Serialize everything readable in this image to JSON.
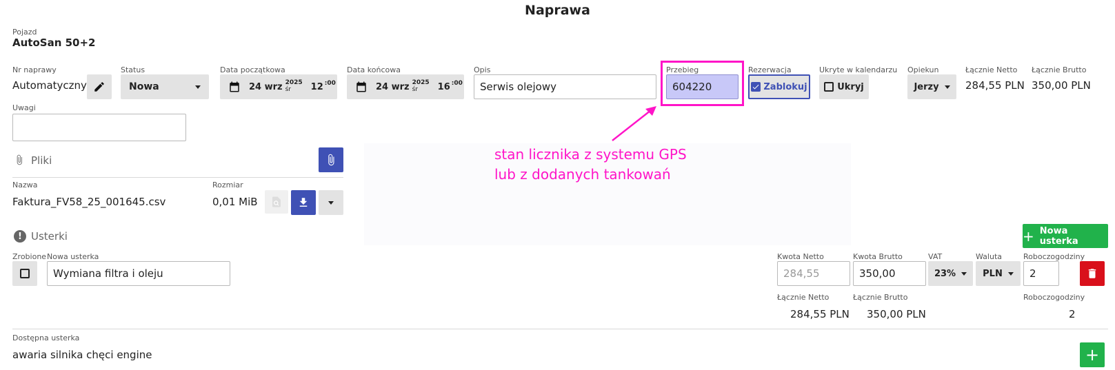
{
  "title": "Naprawa",
  "vehicle": {
    "label": "Pojazd",
    "value": "AutoSan 50+2"
  },
  "fields": {
    "nr_label": "Nr naprawy",
    "nr_value": "Automatyczny",
    "status_label": "Status",
    "status_value": "Nowa",
    "start_label": "Data początkowa",
    "start_day": "24 wrz",
    "start_year": "2025",
    "start_weekday": "śr",
    "start_hour": "12",
    "start_min": "00",
    "end_label": "Data końcowa",
    "end_day": "24 wrz",
    "end_year": "2025",
    "end_weekday": "śr",
    "end_hour": "16",
    "end_min": "00",
    "desc_label": "Opis",
    "desc_value": "Serwis olejowy",
    "mileage_label": "Przebieg",
    "mileage_value": "604220",
    "reservation_label": "Rezerwacja",
    "reservation_value": "Zablokuj",
    "hidden_label": "Ukryte w kalendarzu",
    "hidden_value": "Ukryj",
    "caretaker_label": "Opiekun",
    "caretaker_value": "Jerzy",
    "net_label": "Łącznie Netto",
    "net_value": "284,55 PLN",
    "gross_label": "Łącznie Brutto",
    "gross_value": "350,00 PLN",
    "notes_label": "Uwagi"
  },
  "annotation": {
    "line1": "stan licznika z systemu GPS",
    "line2": "lub z dodanych tankowań"
  },
  "files": {
    "heading": "Pliki",
    "name_label": "Nazwa",
    "size_label": "Rozmiar",
    "file_name": "Faktura_FV58_25_001645.csv",
    "file_size": "0,01 MiB"
  },
  "defects": {
    "heading": "Usterki",
    "new_button": "Nowa usterka",
    "done_label": "Zrobione",
    "new_label": "Nowa usterka",
    "new_value": "Wymiana filtra i oleju",
    "net_amount_label": "Kwota Netto",
    "net_amount_placeholder": "284,55",
    "gross_amount_label": "Kwota Brutto",
    "gross_amount_value": "350,00",
    "vat_label": "VAT",
    "vat_value": "23%",
    "currency_label": "Waluta",
    "currency_value": "PLN",
    "hours_label": "Roboczogodziny",
    "hours_value": "2",
    "sum_net_label": "Łącznie Netto",
    "sum_net_value": "284,55 PLN",
    "sum_gross_label": "Łącznie Brutto",
    "sum_gross_value": "350,00 PLN",
    "sum_hours_label": "Roboczogodziny",
    "sum_hours_value": "2",
    "available_label": "Dostępna usterka",
    "available_value": "awaria silnika chęci engine"
  },
  "colors": {
    "accent_blue": "#3f51b5",
    "accent_green": "#21b24b",
    "danger_red": "#d9101b",
    "annotation_magenta": "#ff14c8"
  }
}
